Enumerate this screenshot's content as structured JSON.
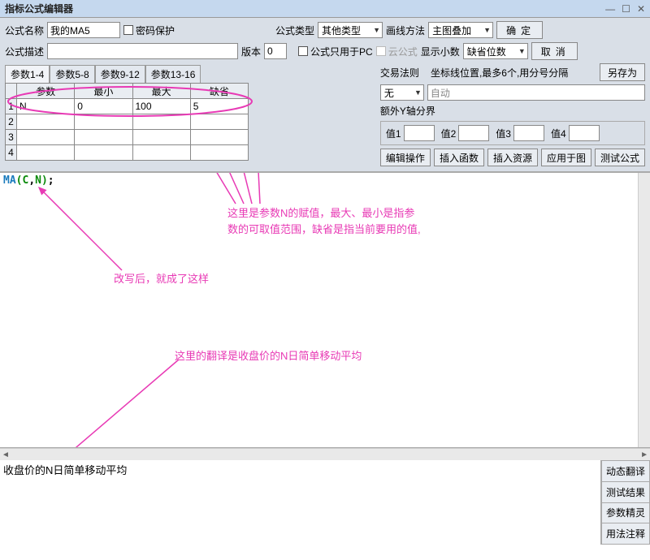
{
  "window": {
    "title": "指标公式编辑器"
  },
  "labels": {
    "name": "公式名称",
    "pwd_protect": "密码保护",
    "formula_type": "公式类型",
    "draw_method": "画线方法",
    "ok": "确定",
    "desc": "公式描述",
    "version": "版本",
    "only_pc": "公式只用于PC",
    "cloud": "云公式",
    "decimals": "显示小数",
    "cancel": "取消",
    "trade_rule": "交易法则",
    "coord_hint": "坐标线位置,最多6个,用分号分隔",
    "save_as": "另存为",
    "extra_y": "额外Y轴分界",
    "v1": "值1",
    "v2": "值2",
    "v3": "值3",
    "v4": "值4",
    "edit_op": "编辑操作",
    "insert_fn": "插入函数",
    "insert_res": "插入资源",
    "apply_fig": "应用于图",
    "test_formula": "测试公式"
  },
  "fields": {
    "name_value": "我的MA5",
    "version_value": "0",
    "formula_type_value": "其他类型",
    "draw_method_value": "主图叠加",
    "decimals_value": "缺省位数",
    "trade_rule_value": "无",
    "coord_value": "自动"
  },
  "tabs": [
    "参数1-4",
    "参数5-8",
    "参数9-12",
    "参数13-16"
  ],
  "param_headers": [
    "参数",
    "最小",
    "最大",
    "缺省"
  ],
  "params": [
    {
      "name": "N",
      "min": "0",
      "max": "100",
      "def": "5"
    },
    {
      "name": "",
      "min": "",
      "max": "",
      "def": ""
    },
    {
      "name": "",
      "min": "",
      "max": "",
      "def": ""
    },
    {
      "name": "",
      "min": "",
      "max": "",
      "def": ""
    }
  ],
  "code": {
    "fn": "MA",
    "arg1": "C",
    "arg2": "N"
  },
  "annotations": {
    "a1_line1": "这里是参数N的赋值，最大、最小是指参",
    "a1_line2": "数的可取值范围，缺省是指当前要用的值,",
    "a2": "改写后，就成了这样",
    "a3": "这里的翻译是收盘价的N日简单移动平均"
  },
  "status_text": "收盘价的N日简单移动平均",
  "side_buttons": [
    "动态翻译",
    "测试结果",
    "参数精灵",
    "用法注释"
  ]
}
